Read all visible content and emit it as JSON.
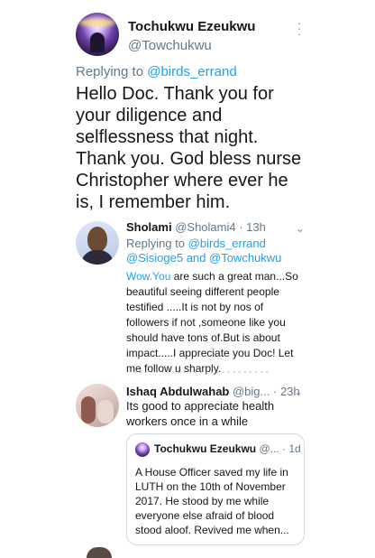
{
  "main_tweet": {
    "name": "Tochukwu Ezeukwu",
    "handle": "@Towchukwu",
    "more_icon": "more-dots-icon",
    "replying_prefix": "Replying to",
    "replying_to": "@birds_errand",
    "text": "Hello Doc. Thank you for your diligence and selflessness that night. Thank you. God bless nurse Christopher where ever he is, I remember him."
  },
  "reply1": {
    "name": "Sholami",
    "handle": "@Sholami4",
    "sep": " · ",
    "time": "13h",
    "replying_prefix": "Replying to",
    "replying_to_1": "@birds_errand",
    "replying_to_2": "@Sisioge5",
    "replying_and": " and ",
    "replying_to_3": "@Towchukwu",
    "text_link": "Wow.You",
    "text": " are such a great man...So beautiful seeing different people testified .....It is not by nos of followers if not ,someone like you should have tons of.But is about impact.....I appreciate you Doc! Let me follow u sharply."
  },
  "reply2": {
    "name": "Ishaq Abdulwahab",
    "handle": "@big...",
    "sep": " · ",
    "time": "23h",
    "text": "Its good to appreciate health workers once in a while",
    "quote": {
      "name": "Tochukwu Ezeukwu",
      "handle": "@...",
      "sep": " · ",
      "time": "1d",
      "text": "A House Officer saved my life in LUTH on the 10th of November 2017. He stood by me while everyone else afraid of blood stood aloof. Revived me when..."
    }
  },
  "colors": {
    "link": "#1da1f2",
    "muted": "#657786",
    "text": "#14171a",
    "border": "#cfd9de"
  }
}
